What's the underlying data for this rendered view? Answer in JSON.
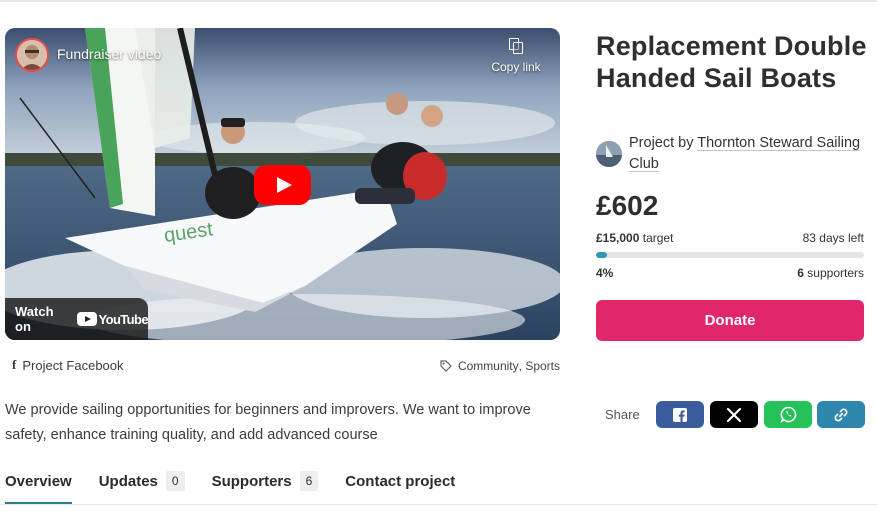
{
  "video": {
    "title": "Fundraiser video",
    "copy_link_label": "Copy link",
    "watch_on_label": "Watch on",
    "youtube_brand": "YouTube",
    "boat_label": "quest"
  },
  "links": {
    "facebook_label": "Project Facebook"
  },
  "tags": [
    "Community",
    "Sports"
  ],
  "description": "We provide sailing opportunities for beginners and improvers. We want to improve safety, enhance training quality, and add advanced course",
  "tabs": [
    {
      "label": "Overview",
      "active": true
    },
    {
      "label": "Updates",
      "count": "0"
    },
    {
      "label": "Supporters",
      "count": "6"
    },
    {
      "label": "Contact project"
    }
  ],
  "project": {
    "title": "Replacement Double Handed Sail Boats",
    "owner_prefix": "Project by",
    "owner_name": "Thornton Steward Sailing Club"
  },
  "funding": {
    "raised": "£602",
    "target_amount": "£15,000",
    "target_label": "target",
    "days_left": "83 days left",
    "percent": "4%",
    "progress_fraction": 0.04,
    "supporters_count": "6",
    "supporters_label": "supporters"
  },
  "donate_label": "Donate",
  "share": {
    "label": "Share",
    "buttons": [
      {
        "name": "facebook",
        "icon": "facebook-icon",
        "color": "#3b5c9a"
      },
      {
        "name": "x",
        "icon": "x-icon",
        "color": "#000000"
      },
      {
        "name": "whatsapp",
        "icon": "whatsapp-icon",
        "color": "#25c25a"
      },
      {
        "name": "copy-link",
        "icon": "link-icon",
        "color": "#2f86ad"
      }
    ]
  },
  "colors": {
    "donate": "#e0276c",
    "progress": "#2f98b3",
    "tab_underline": "#2a7f8c",
    "youtube_red": "#ff0000"
  }
}
